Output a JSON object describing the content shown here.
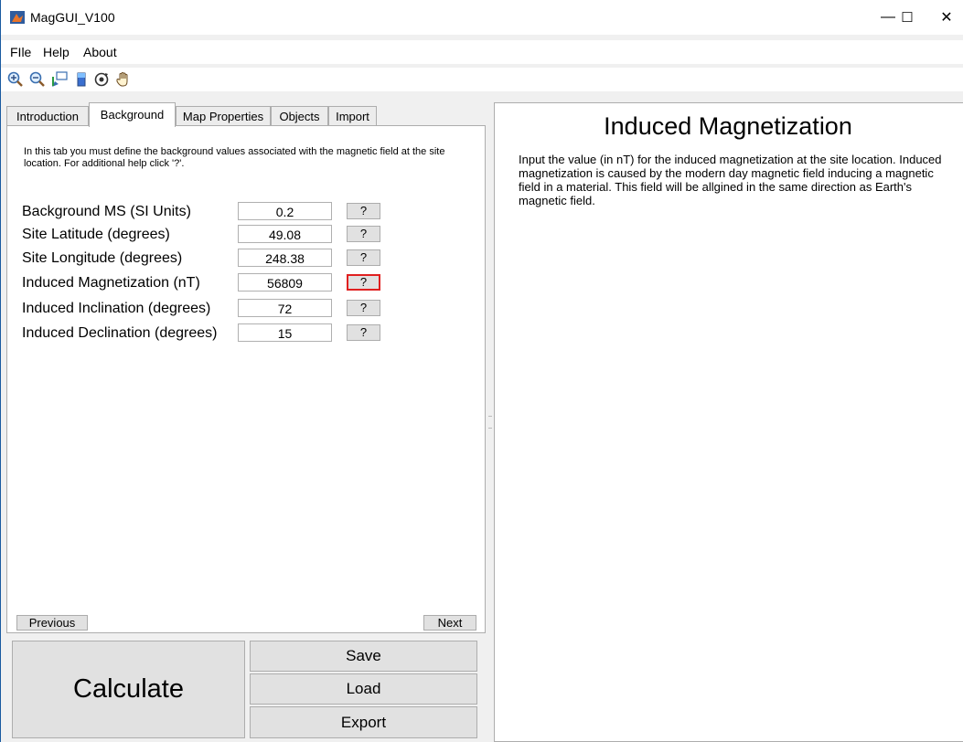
{
  "window": {
    "title": "MagGUI_V100",
    "minimize": "—",
    "maximize": "☐",
    "close": "✕"
  },
  "menu": [
    "FIle",
    "Help",
    "About"
  ],
  "toolbar": [
    "zoom-in-icon",
    "zoom-out-icon",
    "data-cursor-icon",
    "colorbar-icon",
    "rotate-icon",
    "pan-hand-icon"
  ],
  "tabs": [
    "Introduction",
    "Background",
    "Map Properties",
    "Objects",
    "Import"
  ],
  "active_tab": "Background",
  "background_tab": {
    "description": "In this tab you must define the background values associated with the magnetic field at the site location. For additional help click '?'.",
    "fields": [
      {
        "label": "Background MS (SI Units)",
        "value": "0.2",
        "help": "?"
      },
      {
        "label": "Site Latitude (degrees)",
        "value": "49.08",
        "help": "?"
      },
      {
        "label": "Site Longitude (degrees)",
        "value": "248.38",
        "help": "?"
      },
      {
        "label": "Induced Magnetization (nT)",
        "value": "56809",
        "help": "?"
      },
      {
        "label": "Induced Inclination (degrees)",
        "value": "72",
        "help": "?"
      },
      {
        "label": "Induced Declination (degrees)",
        "value": "15",
        "help": "?"
      }
    ],
    "previous": "Previous",
    "next": "Next"
  },
  "actions": {
    "calculate": "Calculate",
    "save": "Save",
    "load": "Load",
    "export": "Export"
  },
  "help_panel": {
    "title": "Induced Magnetization",
    "text": "Input the value (in nT) for the induced magnetization at the site location. Induced magnetization is caused by the modern day magnetic field inducing a magnetic field in a material. This field will be allgined in the same direction as Earth's magnetic field."
  },
  "colors": {
    "selected_help_border": "#e02020",
    "window_border": "#1a5aa0"
  }
}
